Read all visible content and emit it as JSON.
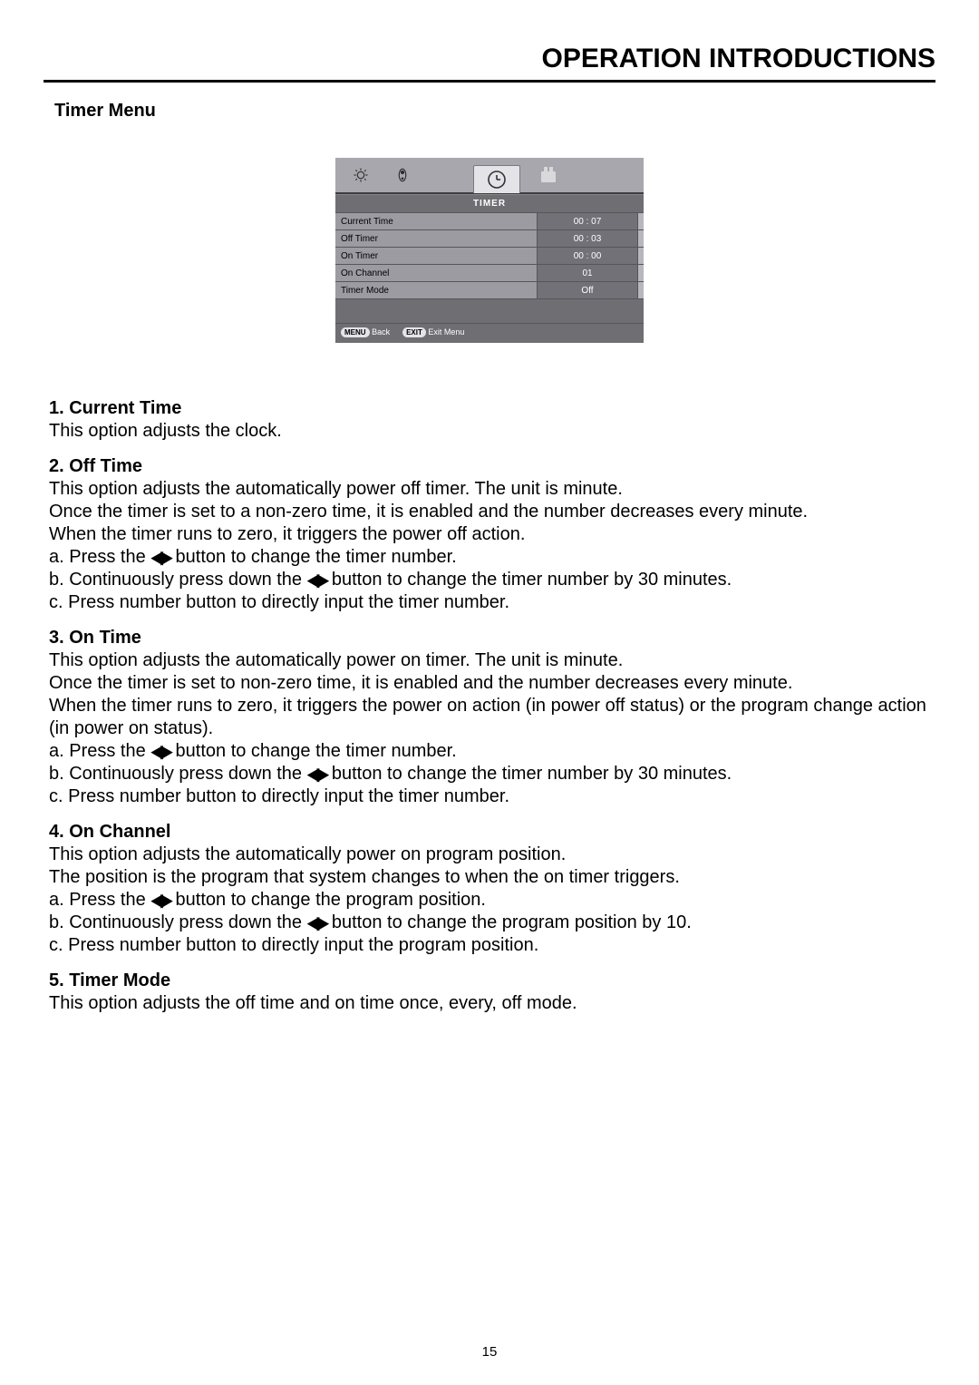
{
  "header": {
    "title": "OPERATION INTRODUCTIONS"
  },
  "section_title": "Timer Menu",
  "osd": {
    "title": "TIMER",
    "rows": [
      {
        "label": "Current Time",
        "value": "00 : 07"
      },
      {
        "label": "Off Timer",
        "value": "00 : 03"
      },
      {
        "label": "On Timer",
        "value": "00 : 00"
      },
      {
        "label": "On Channel",
        "value": "01"
      },
      {
        "label": "Timer Mode",
        "value": "Off"
      }
    ],
    "footer": {
      "menu_pill": "MENU",
      "back_label": "Back",
      "exit_pill": "EXIT",
      "exit_label": "Exit Menu"
    }
  },
  "arrows": "◀▶",
  "items": [
    {
      "heading": "1. Current Time",
      "lines": [
        "This option adjusts the clock."
      ]
    },
    {
      "heading": "2. Off Time",
      "lines": [
        "This option adjusts the automatically power off timer. The unit is minute.",
        "Once the timer is set to a non-zero time, it is enabled and the number decreases every minute.",
        "When the timer runs to zero, it triggers the power off action.",
        "a. Press the {ARROWS} button to change the timer number.",
        "b. Continuously press down the {ARROWS} button to change the timer number by 30 minutes.",
        "c. Press number button to directly input the timer number."
      ]
    },
    {
      "heading": "3. On Time",
      "lines": [
        "This option adjusts the automatically power on timer. The unit is minute.",
        "Once the timer is set to non-zero time, it is enabled and the number decreases every minute.",
        "When the timer runs to zero, it triggers the power on action (in power off status) or the program change action (in power on status).",
        "a. Press the {ARROWS}  button to change the timer number.",
        "b. Continuously press down the {ARROWS} button to change the timer number by 30 minutes.",
        "c. Press number button to directly input the timer number."
      ]
    },
    {
      "heading": "4. On Channel",
      "lines": [
        "This option adjusts the automatically power on program position.",
        "The position is the program that system changes to when the on timer triggers.",
        "a. Press the {ARROWS} button to change the program position.",
        "b. Continuously press down the {ARROWS} button to change the program position by 10.",
        "c. Press number button to directly input the program position."
      ]
    },
    {
      "heading": "5. Timer Mode",
      "lines": [
        "This option adjusts the off time and on time once, every, off mode."
      ]
    }
  ],
  "page_number": "15"
}
